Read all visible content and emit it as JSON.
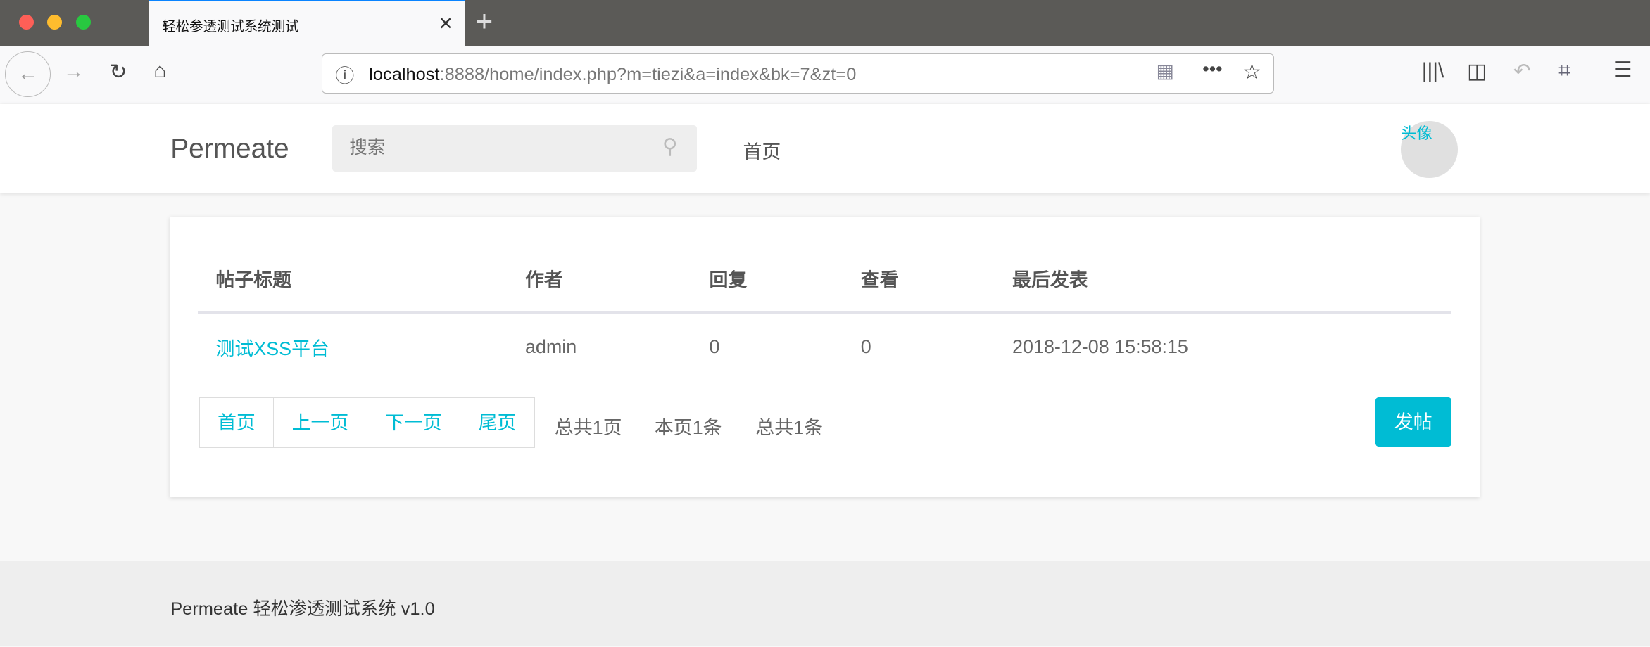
{
  "browser": {
    "tab_title": "轻松参透测试系统测试",
    "url_host": "localhost",
    "url_rest": ":8888/home/index.php?m=tiezi&a=index&bk=7&zt=0"
  },
  "header": {
    "logo": "Permeate",
    "search_placeholder": "搜索",
    "nav_home": "首页",
    "avatar_label": "头像"
  },
  "table": {
    "columns": [
      "帖子标题",
      "作者",
      "回复",
      "查看",
      "最后发表"
    ],
    "rows": [
      {
        "title": "测试XSS平台",
        "author": "admin",
        "replies": "0",
        "views": "0",
        "last_post": "2018-12-08 15:58:15"
      }
    ]
  },
  "pagination": {
    "first": "首页",
    "prev": "上一页",
    "next": "下一页",
    "last": "尾页",
    "total_pages": "总共1页",
    "page_count": "本页1条",
    "total_count": "总共1条"
  },
  "post_button": "发帖",
  "footer": "Permeate 轻松渗透测试系统 v1.0",
  "colors": {
    "accent": "#00bcd4"
  }
}
